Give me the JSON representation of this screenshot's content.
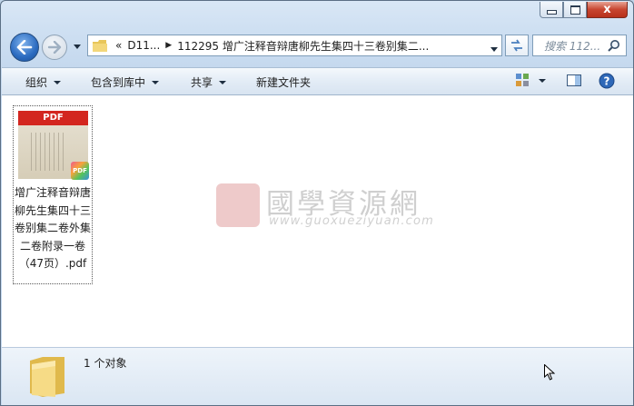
{
  "window": {
    "caption_buttons": {
      "close_label": "x"
    }
  },
  "address_bar": {
    "overflow": "«",
    "crumbs": [
      "D11...",
      "112295 增广注释音辩唐柳先生集四十三卷别集二..."
    ]
  },
  "search": {
    "placeholder": "搜索 112..."
  },
  "toolbar": {
    "organize": "组织",
    "include_in_library": "包含到库中",
    "share": "共享",
    "new_folder": "新建文件夹"
  },
  "file": {
    "thumb_label": "PDF",
    "badge_label": "PDF",
    "name": "增广注释音辩唐柳先生集四十三卷别集二卷外集二卷附录一卷（47页）.pdf"
  },
  "watermark": {
    "title": "國學資源網",
    "url": "www.guoxueziyuan.com"
  },
  "status": {
    "count_text": "1 个对象"
  },
  "colors": {
    "accent": "#2b6bc0",
    "close": "#c7452f",
    "pdf_red": "#d3261f"
  }
}
